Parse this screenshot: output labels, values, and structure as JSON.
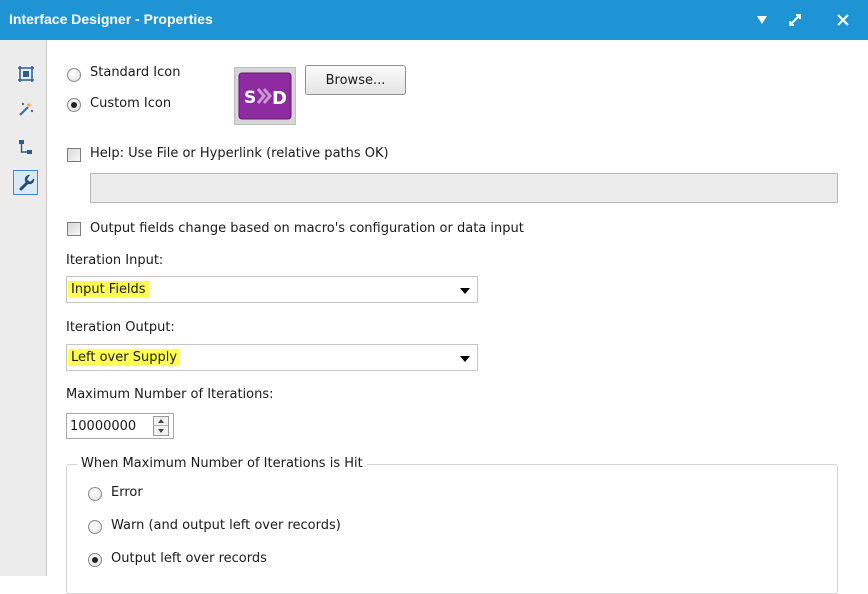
{
  "window": {
    "title": "Interface Designer - Properties"
  },
  "titlebar_controls": [
    "dropdown-arrow-icon",
    "restore-icon",
    "close-icon"
  ],
  "sidebar": {
    "items": [
      {
        "icon": "layout-icon",
        "active": false
      },
      {
        "icon": "magic-wand-icon",
        "active": false
      },
      {
        "icon": "tree-icon",
        "active": false
      },
      {
        "icon": "wrench-icon",
        "active": true
      }
    ]
  },
  "icon_section": {
    "standard_label": "Standard Icon",
    "custom_label": "Custom Icon",
    "selected": "custom",
    "icon_text_left": "S",
    "icon_text_right": "D",
    "browse_label": "Browse..."
  },
  "help": {
    "label": "Help: Use File or Hyperlink (relative paths OK)",
    "checked": false,
    "value": ""
  },
  "output_fields": {
    "label": "Output fields change based on macro's configuration or data input",
    "checked": false
  },
  "iteration_input": {
    "label": "Iteration Input:",
    "value": "Input Fields"
  },
  "iteration_output": {
    "label": "Iteration Output:",
    "value": "Left over Supply"
  },
  "max_iterations": {
    "label": "Maximum Number of Iterations:",
    "value": "10000000"
  },
  "max_hit": {
    "legend": "When Maximum Number of Iterations is Hit",
    "options": [
      {
        "label": "Error",
        "checked": false
      },
      {
        "label": "Warn (and output left over records)",
        "checked": false
      },
      {
        "label": "Output left over records",
        "checked": true
      }
    ]
  },
  "colors": {
    "titlebar": "#1e94d4",
    "highlight": "#ffff54",
    "icon_purple": "#8e2ba0"
  }
}
